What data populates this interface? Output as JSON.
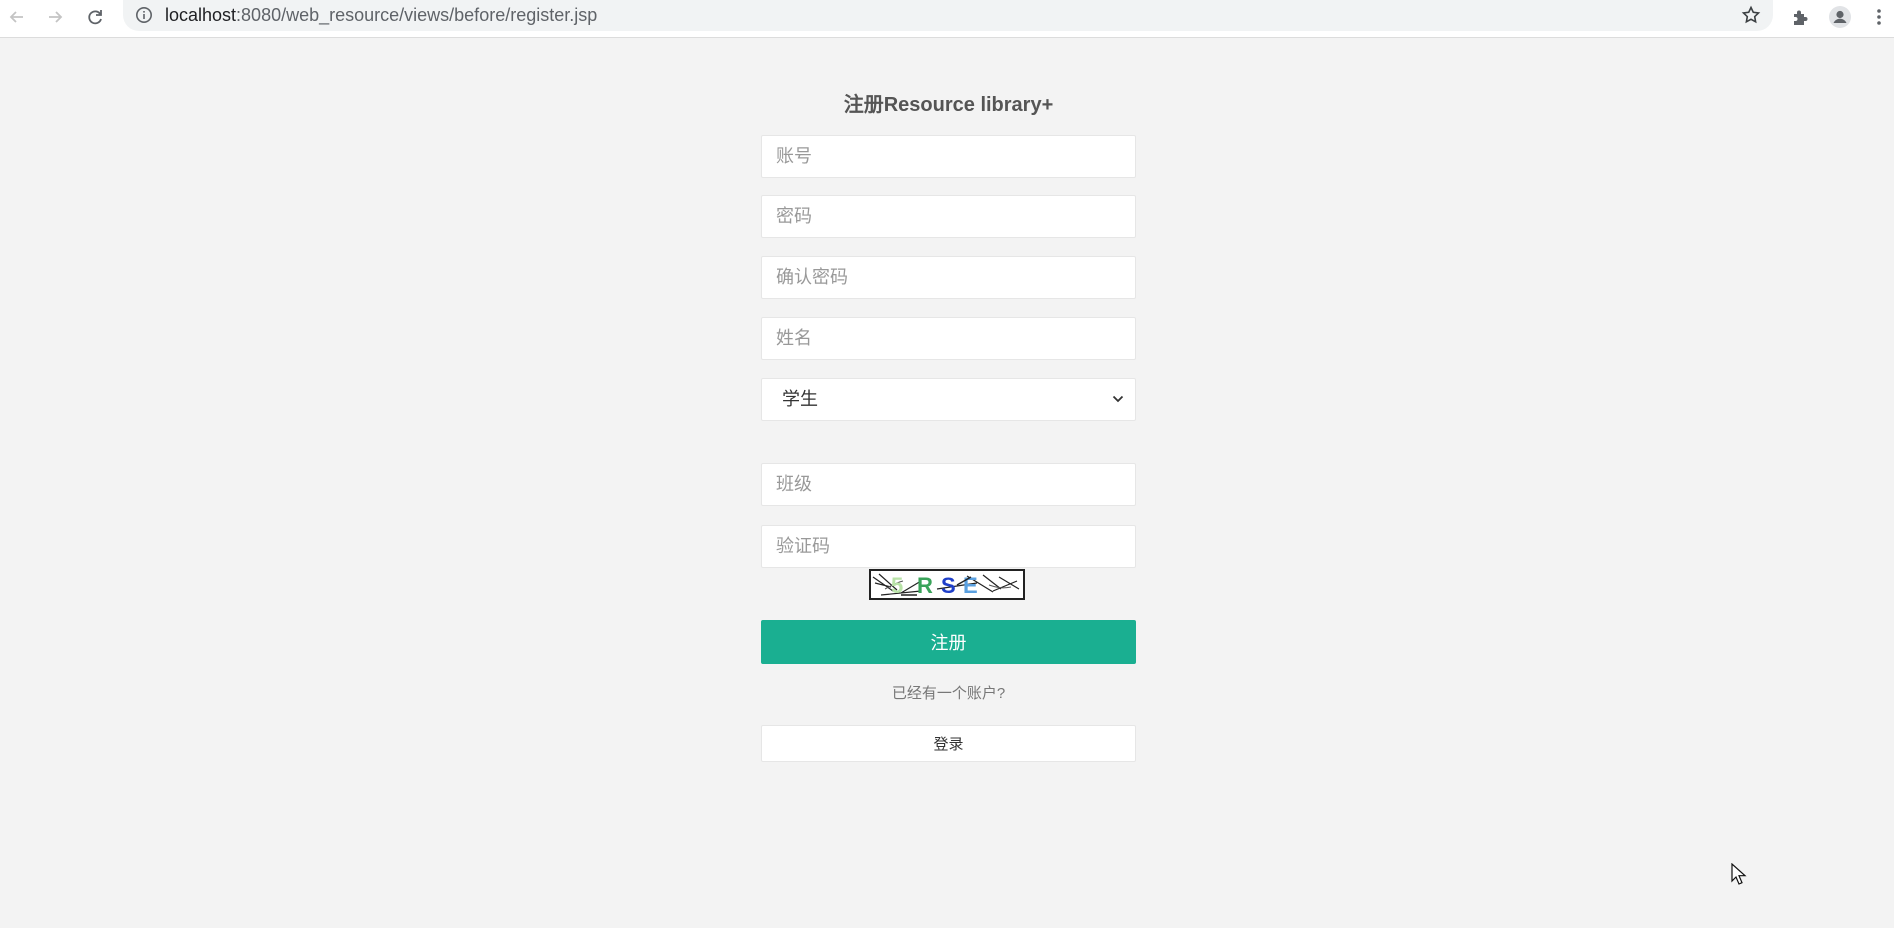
{
  "browser": {
    "url_host": "localhost",
    "url_rest": ":8080/web_resource/views/before/register.jsp"
  },
  "form": {
    "title": "注册Resource library+",
    "account_placeholder": "账号",
    "password_placeholder": "密码",
    "confirm_password_placeholder": "确认密码",
    "name_placeholder": "姓名",
    "role_selected": "学生",
    "class_placeholder": "班级",
    "captcha_placeholder": "验证码",
    "captcha_text": "5RSE",
    "submit_label": "注册",
    "have_account_text": "已经有一个账户?",
    "login_label": "登录"
  },
  "colors": {
    "accent": "#1aaf91",
    "page_bg": "#f3f3f3"
  }
}
